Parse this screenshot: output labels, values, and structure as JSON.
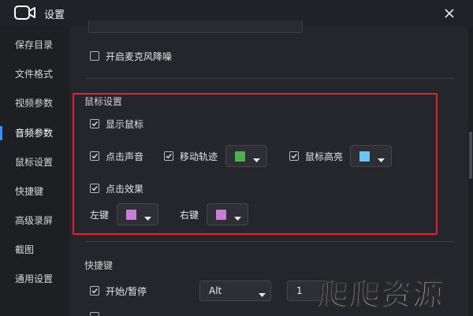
{
  "window": {
    "title": "设置",
    "icon": "video-camera-icon",
    "close": "close-icon"
  },
  "sidebar": {
    "items": [
      {
        "label": "保存目录",
        "active": false
      },
      {
        "label": "文件格式",
        "active": false
      },
      {
        "label": "视频参数",
        "active": false
      },
      {
        "label": "音频参数",
        "active": true
      },
      {
        "label": "鼠标设置",
        "active": false
      },
      {
        "label": "快捷键",
        "active": false
      },
      {
        "label": "高级录屏",
        "active": false
      },
      {
        "label": "截图",
        "active": false
      },
      {
        "label": "通用设置",
        "active": false
      }
    ],
    "accent_color": "#3a8ef7"
  },
  "audio": {
    "noise_label": "开启麦克风降噪",
    "noise_checked": false
  },
  "mouse": {
    "section_title": "鼠标设置",
    "show_cursor_label": "显示鼠标",
    "show_cursor_checked": true,
    "click_sound_label": "点击声音",
    "click_sound_checked": true,
    "move_track_label": "移动轨迹",
    "move_track_checked": true,
    "move_track_color": "#4caf50",
    "cursor_highlight_label": "鼠标高亮",
    "cursor_highlight_checked": true,
    "cursor_highlight_color": "#67c4f5",
    "click_effect_label": "点击效果",
    "click_effect_checked": true,
    "left_key_label": "左键",
    "left_key_color": "#c77ed8",
    "right_key_label": "右键",
    "right_key_color": "#c77ed8",
    "highlight_box_color": "#e8202a"
  },
  "shortcuts": {
    "section_title": "快捷键",
    "start_pause_label": "开始/暂停",
    "start_pause_checked": true,
    "modifier_value": "Alt",
    "key_value": "1"
  },
  "watermark": "爬爬资源"
}
